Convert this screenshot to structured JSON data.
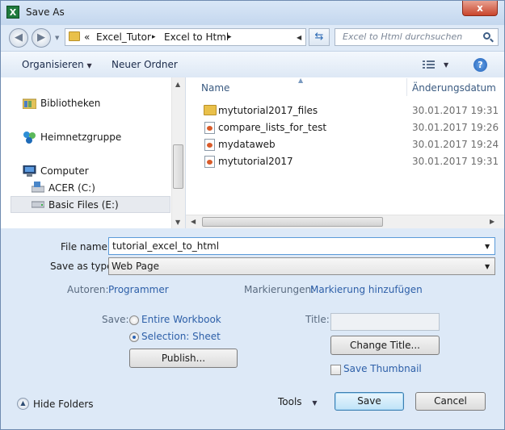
{
  "window": {
    "title": "Save As",
    "close_label": "x"
  },
  "app_icon": {
    "glyph": "X",
    "name": "excel-icon"
  },
  "nav": {
    "breadcrumb_prefix": "«",
    "crumbs": [
      "Excel_Tutor",
      "Excel to Html"
    ],
    "crumb_sep": "▸",
    "search_placeholder": "Excel to Html durchsuchen"
  },
  "toolbar": {
    "organize": "Organisieren",
    "new_folder": "Neuer Ordner"
  },
  "sidebar": {
    "items": [
      {
        "label": "Bibliotheken",
        "icon": "library-icon"
      },
      {
        "label": "Heimnetzgruppe",
        "icon": "homegroup-icon"
      },
      {
        "label": "Computer",
        "icon": "computer-icon"
      },
      {
        "label": "ACER (C:)",
        "icon": "drive-icon"
      },
      {
        "label": "Basic Files (E:)",
        "icon": "drive-icon"
      }
    ]
  },
  "file_list": {
    "columns": {
      "name": "Name",
      "date": "Änderungsdatum"
    },
    "rows": [
      {
        "name": "mytutorial2017_files",
        "date": "30.01.2017 19:31",
        "type": "folder"
      },
      {
        "name": "compare_lists_for_test",
        "date": "30.01.2017 19:26",
        "type": "file"
      },
      {
        "name": "mydataweb",
        "date": "30.01.2017 19:24",
        "type": "file"
      },
      {
        "name": "mytutorial2017",
        "date": "30.01.2017 19:31",
        "type": "file"
      }
    ]
  },
  "form": {
    "file_name_label": "File name:",
    "file_name_value": "tutorial_excel_to_html",
    "save_type_label": "Save as type:",
    "save_type_value": "Web Page",
    "authors_label": "Autoren:",
    "authors_value": "Programmer",
    "tags_label": "Markierungen:",
    "tags_value": "Markierung hinzufügen",
    "save_label": "Save:",
    "option_workbook": "Entire Workbook",
    "option_selection": "Selection: Sheet",
    "selected_option": "Selection: Sheet",
    "publish_button": "Publish...",
    "title_label": "Title:",
    "title_value": "",
    "change_title_button": "Change Title...",
    "save_thumbnail": "Save Thumbnail"
  },
  "footer": {
    "hide_folders": "Hide Folders",
    "tools": "Tools",
    "save": "Save",
    "cancel": "Cancel"
  }
}
